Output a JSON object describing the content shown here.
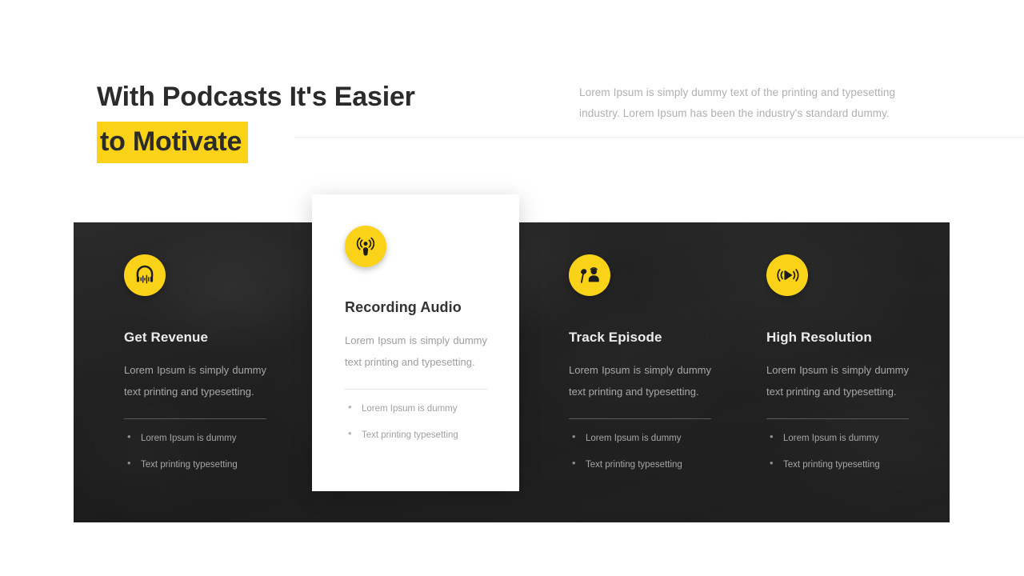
{
  "header": {
    "title_line1": "With Podcasts It's Easier",
    "title_line2": "to Motivate",
    "paragraph": "Lorem Ipsum is simply dummy text of the printing and typesetting industry. Lorem Ipsum has been the industry's standard dummy."
  },
  "theme": {
    "accent": "#fad218",
    "panel_dark": "#2a2a2a",
    "title_color": "#2b2b2b",
    "body_text": "#a8a8a8"
  },
  "cards": [
    {
      "id": "get-revenue",
      "icon": "headphones-soundwave-icon",
      "title": "Get Revenue",
      "description": "Lorem Ipsum is simply dummy text printing and typesetting.",
      "bullets": [
        "Lorem Ipsum is dummy",
        "Text printing typesetting"
      ]
    },
    {
      "id": "recording-audio",
      "icon": "podcast-microphone-icon",
      "title": "Recording Audio",
      "description": "Lorem Ipsum is simply dummy text printing and typesetting.",
      "bullets": [
        "Lorem Ipsum is dummy",
        "Text printing typesetting"
      ]
    },
    {
      "id": "track-episode",
      "icon": "person-microphone-icon",
      "title": "Track Episode",
      "description": "Lorem Ipsum is simply dummy text printing and typesetting.",
      "bullets": [
        "Lorem Ipsum is dummy",
        "Text printing typesetting"
      ]
    },
    {
      "id": "high-resolution",
      "icon": "play-broadcast-icon",
      "title": "High Resolution",
      "description": "Lorem Ipsum is simply dummy text printing and typesetting.",
      "bullets": [
        "Lorem Ipsum is dummy",
        "Text printing typesetting"
      ]
    }
  ]
}
